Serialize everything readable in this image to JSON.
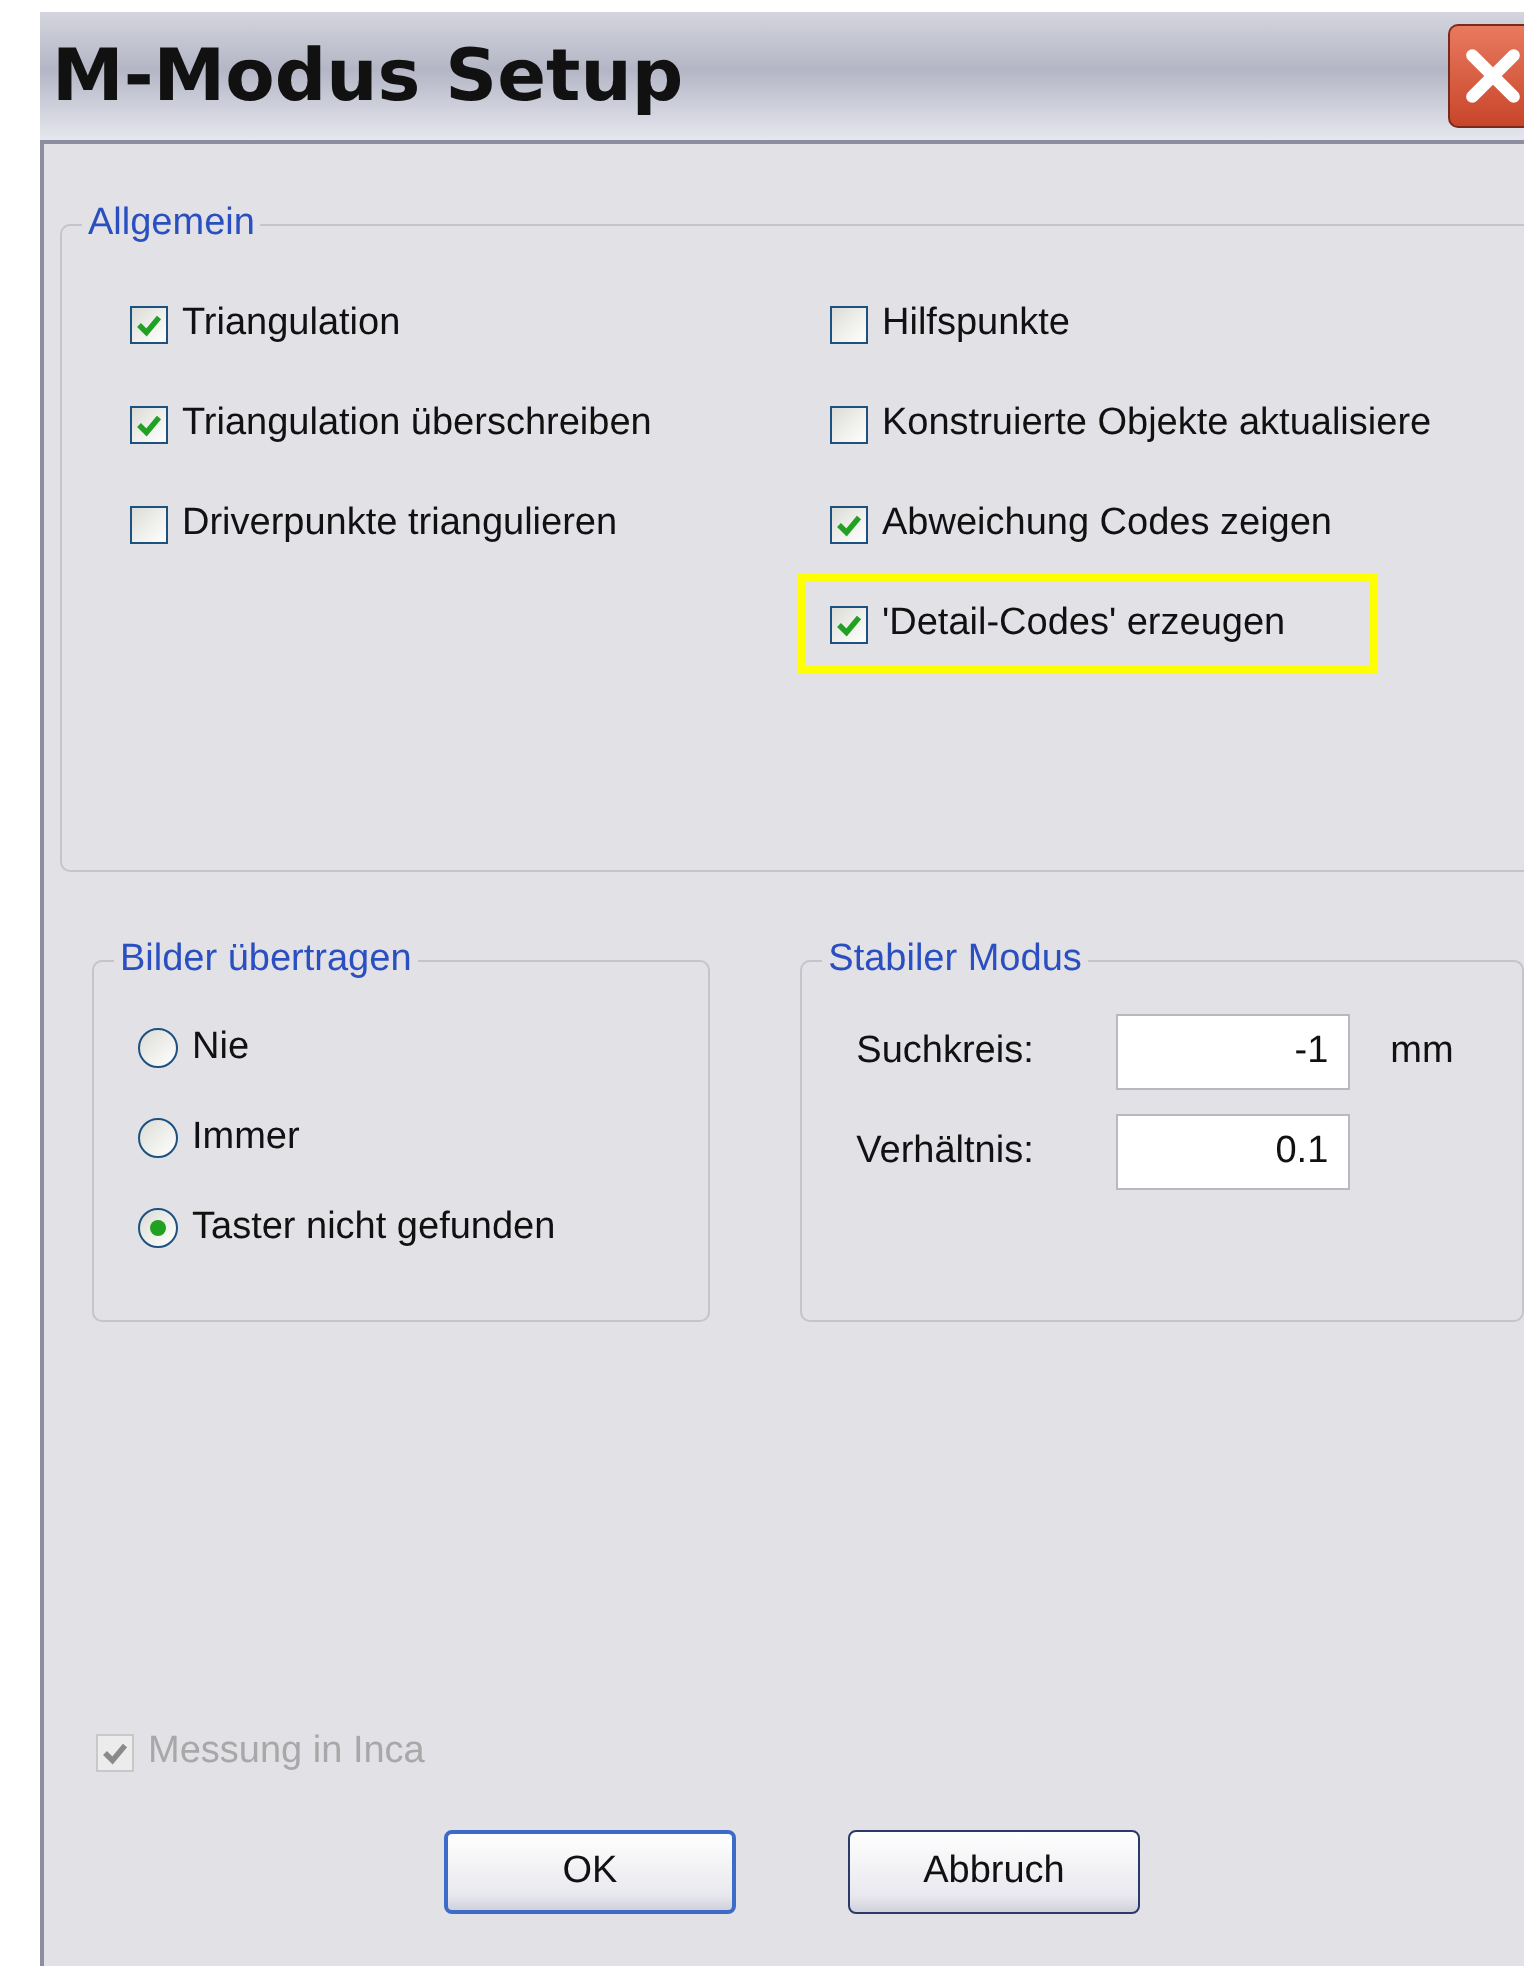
{
  "window": {
    "title": "M-Modus Setup"
  },
  "general": {
    "title": "Allgemein",
    "columns": [
      [
        {
          "label": "Triangulation",
          "checked": true,
          "highlighted": false
        },
        {
          "label": "Triangulation überschreiben",
          "checked": true,
          "highlighted": false
        },
        {
          "label": "Driverpunkte triangulieren",
          "checked": false,
          "highlighted": false
        }
      ],
      [
        {
          "label": "Hilfspunkte",
          "checked": false,
          "highlighted": false
        },
        {
          "label": "Konstruierte Objekte aktualisiere",
          "checked": false,
          "highlighted": false
        },
        {
          "label": "Abweichung Codes zeigen",
          "checked": true,
          "highlighted": false
        },
        {
          "label": "'Detail-Codes' erzeugen",
          "checked": true,
          "highlighted": true
        }
      ]
    ]
  },
  "images": {
    "title": "Bilder übertragen",
    "options": [
      {
        "label": "Nie",
        "selected": false
      },
      {
        "label": "Immer",
        "selected": false
      },
      {
        "label": "Taster nicht gefunden",
        "selected": true
      }
    ]
  },
  "stable": {
    "title": "Stabiler  Modus",
    "fields": [
      {
        "label": "Suchkreis:",
        "value": "-1",
        "unit": "mm"
      },
      {
        "label": "Verhältnis:",
        "value": "0.1"
      }
    ]
  },
  "inca": {
    "label": "Messung in Inca",
    "checked": true,
    "disabled": true
  },
  "buttons": [
    {
      "label": "OK",
      "default": true
    },
    {
      "label": "Abbruch",
      "default": false
    }
  ]
}
